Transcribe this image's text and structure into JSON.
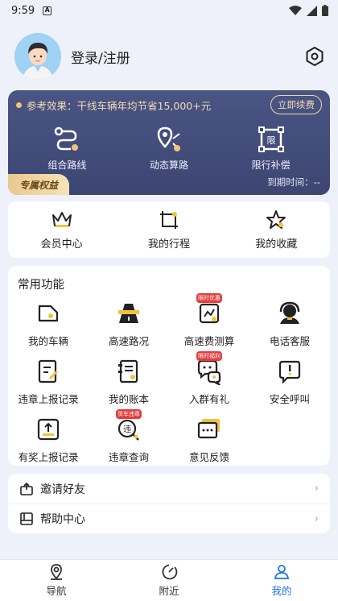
{
  "status_bar": {
    "time": "9:59",
    "notif_icon": "A"
  },
  "header": {
    "login_label": "登录/注册"
  },
  "vip": {
    "prefix": "参考效果：",
    "highlight": "干线车辆年均节省15,000+元",
    "renew_label": "立即续费",
    "items": [
      {
        "label": "组合路线",
        "icon": "route-icon"
      },
      {
        "label": "动态算路",
        "icon": "dynamic-route-icon"
      },
      {
        "label": "限行补偿",
        "icon": "restriction-icon"
      }
    ],
    "exclusive_badge": "专属权益",
    "expire_label": "到期时间：--"
  },
  "quick": [
    {
      "label": "会员中心",
      "icon": "crown-icon"
    },
    {
      "label": "我的行程",
      "icon": "trip-icon"
    },
    {
      "label": "我的收藏",
      "icon": "star-icon"
    }
  ],
  "common": {
    "title": "常用功能",
    "items": [
      {
        "label": "我的车辆"
      },
      {
        "label": "高速路况"
      },
      {
        "label": "高速费测算",
        "tag": "限时优惠"
      },
      {
        "label": "电话客服"
      },
      {
        "label": "违章上报记录"
      },
      {
        "label": "我的账本"
      },
      {
        "label": "入群有礼",
        "tag": "限时福利"
      },
      {
        "label": "安全呼叫"
      },
      {
        "label": "有奖上报记录"
      },
      {
        "label": "违章查询",
        "tag": "货车违章"
      },
      {
        "label": "意见反馈"
      }
    ]
  },
  "list": [
    {
      "label": "邀请好友"
    },
    {
      "label": "帮助中心"
    }
  ],
  "tabs": [
    {
      "label": "导航"
    },
    {
      "label": "附近"
    },
    {
      "label": "我的"
    }
  ],
  "colors": {
    "accent": "#1a73e8",
    "card_bg": "#434d7b",
    "gold": "#f3dbb0",
    "tag_red": "#e53c3c"
  }
}
